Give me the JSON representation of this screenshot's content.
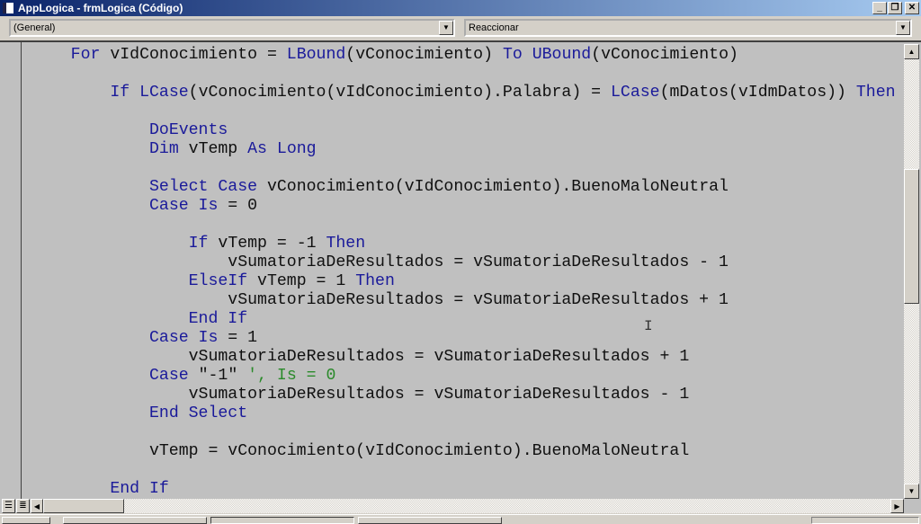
{
  "window": {
    "title": "AppLogica - frmLogica (Código)",
    "controls": {
      "minimize": "_",
      "restore": "❐",
      "close": "✕"
    }
  },
  "object_combo": {
    "value": "(General)"
  },
  "procedure_combo": {
    "value": "Reaccionar"
  },
  "code_lines": [
    [
      {
        "t": "    "
      },
      {
        "t": "For",
        "c": "kw"
      },
      {
        "t": " vIdConocimiento = "
      },
      {
        "t": "LBound",
        "c": "kw"
      },
      {
        "t": "(vConocimiento) "
      },
      {
        "t": "To",
        "c": "kw"
      },
      {
        "t": " "
      },
      {
        "t": "UBound",
        "c": "kw"
      },
      {
        "t": "(vConocimiento)"
      }
    ],
    [],
    [
      {
        "t": "        "
      },
      {
        "t": "If",
        "c": "kw"
      },
      {
        "t": " "
      },
      {
        "t": "LCase",
        "c": "kw"
      },
      {
        "t": "(vConocimiento(vIdConocimiento).Palabra) = "
      },
      {
        "t": "LCase",
        "c": "kw"
      },
      {
        "t": "(mDatos(vIdmDatos)) "
      },
      {
        "t": "Then",
        "c": "kw"
      }
    ],
    [],
    [
      {
        "t": "            "
      },
      {
        "t": "DoEvents",
        "c": "kw"
      }
    ],
    [
      {
        "t": "            "
      },
      {
        "t": "Dim",
        "c": "kw"
      },
      {
        "t": " vTemp "
      },
      {
        "t": "As",
        "c": "kw"
      },
      {
        "t": " "
      },
      {
        "t": "Long",
        "c": "kw"
      }
    ],
    [],
    [
      {
        "t": "            "
      },
      {
        "t": "Select Case",
        "c": "kw"
      },
      {
        "t": " vConocimiento(vIdConocimiento).BuenoMaloNeutral"
      }
    ],
    [
      {
        "t": "            "
      },
      {
        "t": "Case Is",
        "c": "kw"
      },
      {
        "t": " = 0"
      }
    ],
    [],
    [
      {
        "t": "                "
      },
      {
        "t": "If",
        "c": "kw"
      },
      {
        "t": " vTemp = -1 "
      },
      {
        "t": "Then",
        "c": "kw"
      }
    ],
    [
      {
        "t": "                    vSumatoriaDeResultados = vSumatoriaDeResultados - 1"
      }
    ],
    [
      {
        "t": "                "
      },
      {
        "t": "ElseIf",
        "c": "kw"
      },
      {
        "t": " vTemp = 1 "
      },
      {
        "t": "Then",
        "c": "kw"
      }
    ],
    [
      {
        "t": "                    vSumatoriaDeResultados = vSumatoriaDeResultados + 1"
      }
    ],
    [
      {
        "t": "                "
      },
      {
        "t": "End If",
        "c": "kw"
      }
    ],
    [
      {
        "t": "            "
      },
      {
        "t": "Case Is",
        "c": "kw"
      },
      {
        "t": " = 1"
      }
    ],
    [
      {
        "t": "                vSumatoriaDeResultados = vSumatoriaDeResultados + 1"
      }
    ],
    [
      {
        "t": "            "
      },
      {
        "t": "Case",
        "c": "kw"
      },
      {
        "t": " \"-1\" "
      },
      {
        "t": "', Is = 0",
        "c": "cm"
      }
    ],
    [
      {
        "t": "                vSumatoriaDeResultados = vSumatoriaDeResultados - 1"
      }
    ],
    [
      {
        "t": "            "
      },
      {
        "t": "End Select",
        "c": "kw"
      }
    ],
    [],
    [
      {
        "t": "            vTemp = vConocimiento(vIdConocimiento).BuenoMaloNeutral"
      }
    ],
    [],
    [
      {
        "t": "        "
      },
      {
        "t": "End If",
        "c": "kw"
      }
    ]
  ],
  "colors": {
    "keyword": "#1a1a9a",
    "comment": "#2a8a2a",
    "text": "#101010",
    "editor_bg": "#c0c0c0"
  },
  "scroll": {
    "vertical_position_percent": 38,
    "horizontal_position_percent": 0
  }
}
